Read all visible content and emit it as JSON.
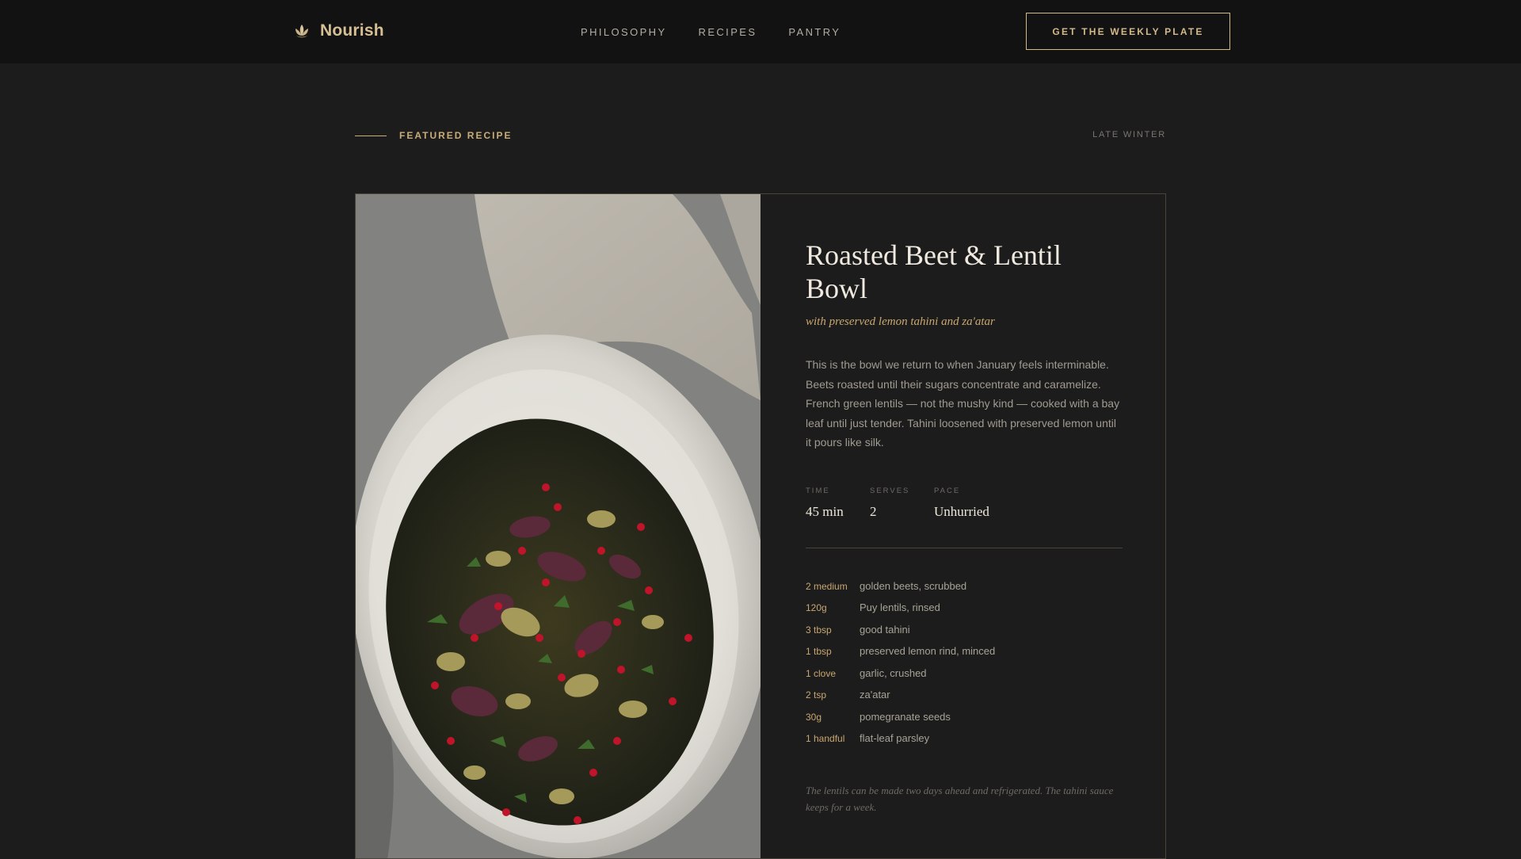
{
  "header": {
    "brand": "Nourish",
    "nav": [
      "PHILOSOPHY",
      "RECIPES",
      "PANTRY"
    ],
    "cta": "GET THE WEEKLY PLATE"
  },
  "section": {
    "label": "FEATURED RECIPE",
    "season": "LATE WINTER"
  },
  "recipe": {
    "title": "Roasted Beet & Lentil Bowl",
    "subtitle": "with preserved lemon tahini and za'atar",
    "description": "This is the bowl we return to when January feels interminable. Beets roasted until their sugars concentrate and caramelize. French green lentils — not the mushy kind — cooked with a bay leaf until just tender. Tahini loosened with preserved lemon until it pours like silk.",
    "meta": [
      {
        "key": "TIME",
        "value": "45 min"
      },
      {
        "key": "SERVES",
        "value": "2"
      },
      {
        "key": "PACE",
        "value": "Unhurried"
      }
    ],
    "ingredients": [
      {
        "qty": "2 medium",
        "item": "golden beets, scrubbed"
      },
      {
        "qty": "120g",
        "item": "Puy lentils, rinsed"
      },
      {
        "qty": "3 tbsp",
        "item": "good tahini"
      },
      {
        "qty": "1 tbsp",
        "item": "preserved lemon rind, minced"
      },
      {
        "qty": "1 clove",
        "item": "garlic, crushed"
      },
      {
        "qty": "2 tsp",
        "item": "za'atar"
      },
      {
        "qty": "30g",
        "item": "pomegranate seeds"
      },
      {
        "qty": "1 handful",
        "item": "flat-leaf parsley"
      }
    ],
    "note": "The lentils can be made two days ahead and refrigerated. The tahini sauce keeps for a week."
  }
}
